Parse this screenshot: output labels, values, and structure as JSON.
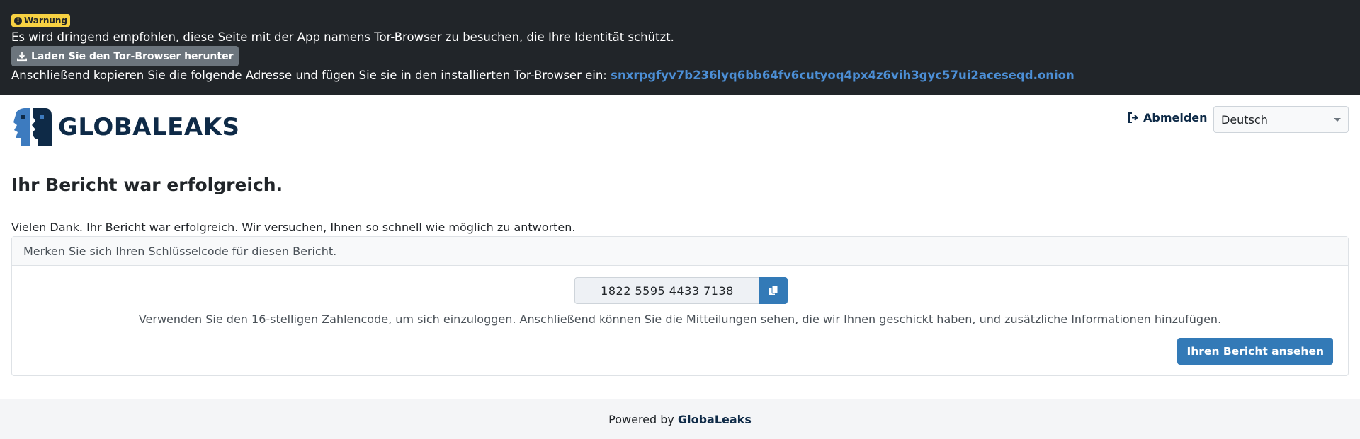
{
  "tor_banner": {
    "warning_label": "Warnung",
    "message": "Es wird dringend empfohlen, diese Seite mit der App namens Tor-Browser zu besuchen, die Ihre Identität schützt.",
    "download_button": "Laden Sie den Tor-Browser herunter",
    "copy_instruction": "Anschließend kopieren Sie die folgende Adresse und fügen Sie sie in den installierten Tor-Browser ein:",
    "onion_address": "snxrpgfyv7b236lyq6bb64fv6cutyoq4px4z6vih3gyc57ui2aceseqd.onion",
    "badge_color": "#f7d142",
    "background_color": "#212529"
  },
  "header": {
    "logo_text": "GLOBALEAKS",
    "logout_label": "Abmelden",
    "language_selected": "Deutsch"
  },
  "main": {
    "title": "Ihr Bericht war erfolgreich.",
    "thanks_text": "Vielen Dank. Ihr Bericht war erfolgreich. Wir versuchen, Ihnen so schnell wie möglich zu antworten.",
    "card_header": "Merken Sie sich Ihren Schlüsselcode für diesen Bericht.",
    "receipt_code": "1822 5595 4433 7138",
    "instructions": "Verwenden Sie den 16-stelligen Zahlencode, um sich einzuloggen. Anschließend können Sie die Mitteilungen sehen, die wir Ihnen geschickt haben, und zusätzliche Informationen hinzufügen.",
    "view_report_button": "Ihren Bericht ansehen",
    "accent_color": "#337ab7"
  },
  "footer": {
    "powered_by": "Powered by",
    "brand": "GlobaLeaks"
  },
  "icons": {
    "warning": "exclamation-circle-icon",
    "download": "download-icon",
    "logout": "sign-out-icon",
    "copy": "copy-icon",
    "logo": "globaleaks-faces-icon"
  }
}
